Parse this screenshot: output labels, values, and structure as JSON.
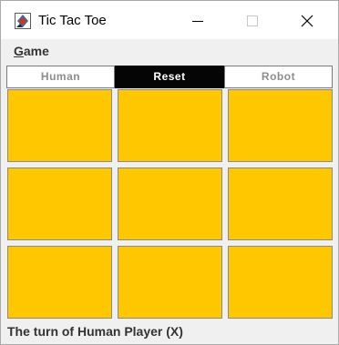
{
  "window": {
    "title": "Tic Tac Toe",
    "icon": "java-app-icon",
    "controls": [
      "minimize-icon",
      "maximize-icon",
      "close-icon"
    ]
  },
  "menu": {
    "game_first": "G",
    "game_rest": "ame"
  },
  "toolbar": {
    "human_label": "Human",
    "reset_label": "Reset",
    "robot_label": "Robot"
  },
  "board": {
    "cells": [
      "",
      "",
      "",
      "",
      "",
      "",
      "",
      "",
      ""
    ],
    "cell_color": "#ffc700"
  },
  "status": {
    "text": "The turn of Human Player (X)"
  }
}
